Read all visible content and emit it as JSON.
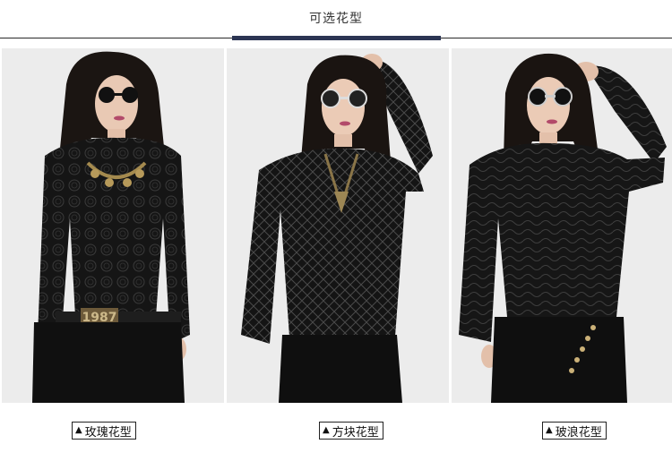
{
  "header": {
    "title": "可选花型"
  },
  "options": [
    {
      "label": "玫瑰花型",
      "marker": "▲"
    },
    {
      "label": "方块花型",
      "marker": "▲"
    },
    {
      "label": "玻浪花型",
      "marker": "▲"
    }
  ],
  "photos": [
    {
      "belt_text": "1987"
    }
  ],
  "colors": {
    "header_bar": "#2c3553",
    "photo_bg": "#ebebeb",
    "garment": "#141414"
  }
}
